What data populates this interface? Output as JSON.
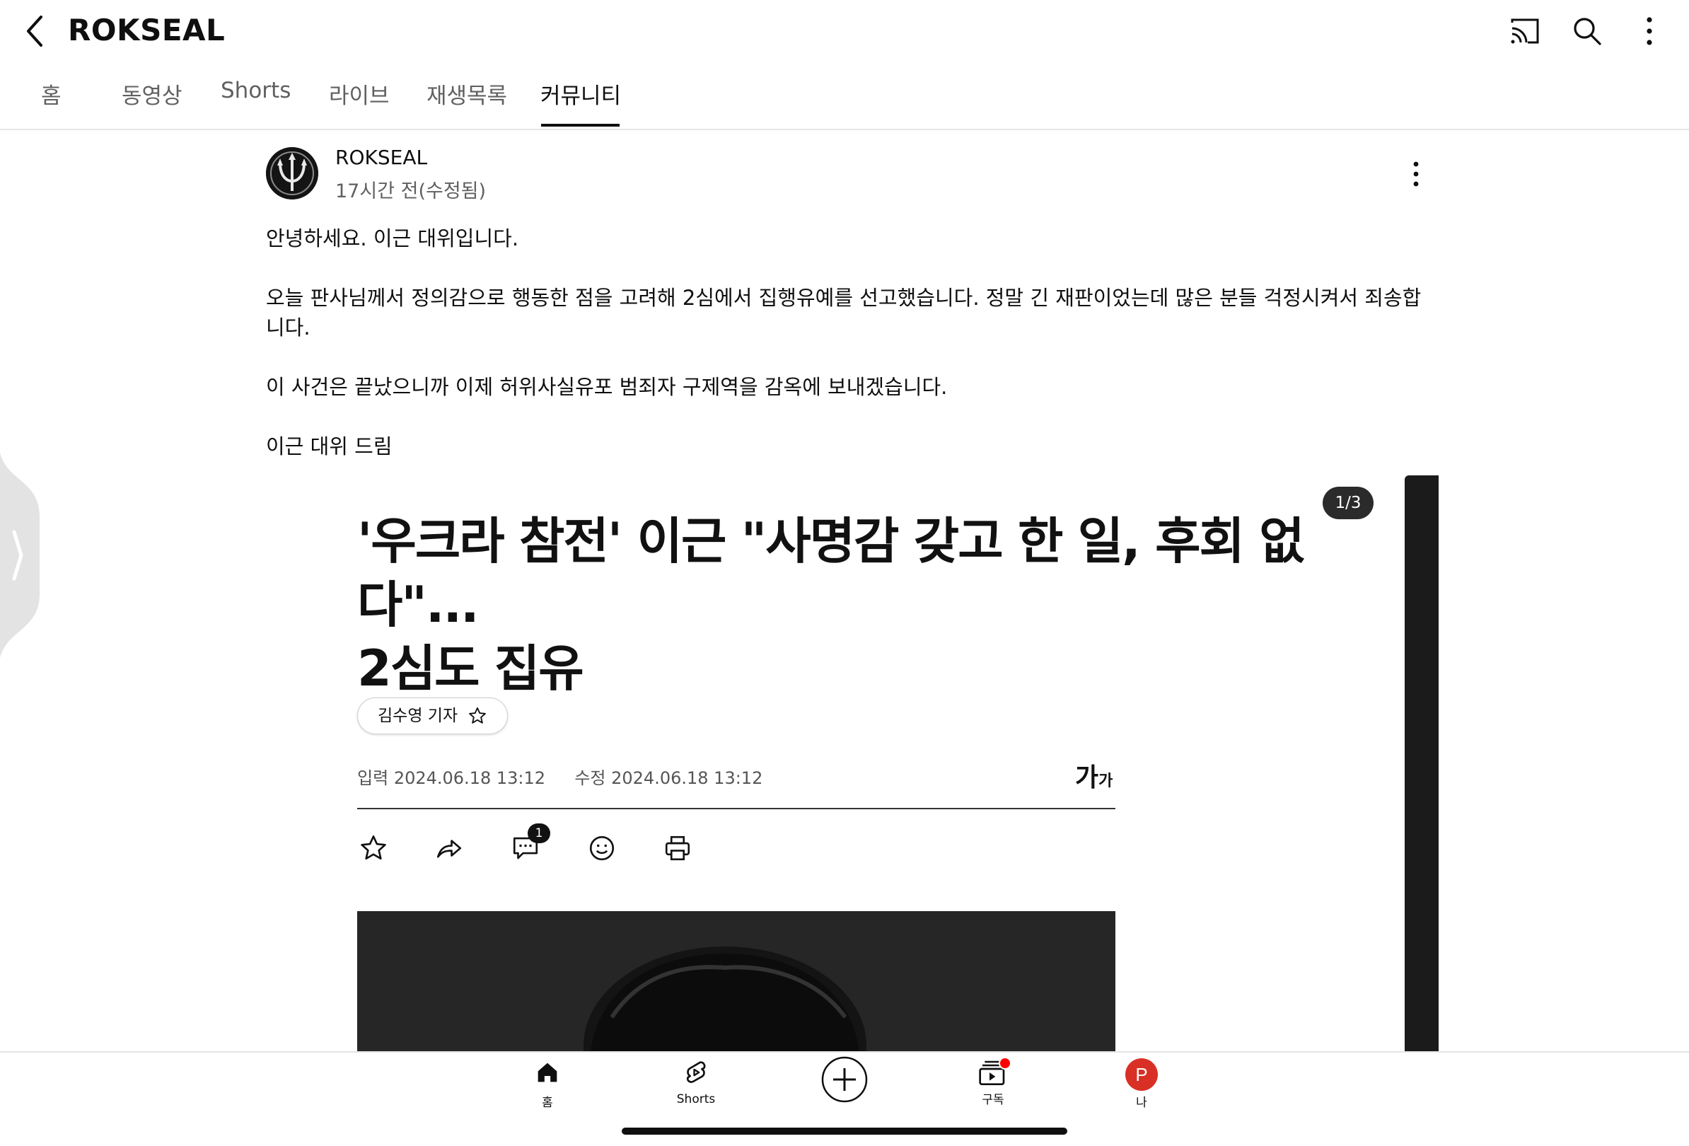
{
  "header": {
    "channel_title": "ROKSEAL",
    "icons": [
      "back-arrow-icon",
      "cast-icon",
      "search-icon",
      "more-vert-icon"
    ]
  },
  "tabs": [
    {
      "label": "홈"
    },
    {
      "label": "동영상"
    },
    {
      "label": "Shorts"
    },
    {
      "label": "라이브"
    },
    {
      "label": "재생목록"
    },
    {
      "label": "커뮤니티",
      "active": true
    }
  ],
  "post": {
    "author": "ROKSEAL",
    "time": "17시간 전(수정됨)",
    "paragraphs": [
      "안녕하세요. 이근 대위입니다.",
      "오늘 판사님께서 정의감으로 행동한 점을 고려해 2심에서 집행유예를 선고했습니다. 정말 긴 재판이었는데 많은 분들 걱정시켜서 죄송합니다.",
      "이 사건은 끝났으니까 이제 허위사실유포 범죄자 구제역을 감옥에 보내겠습니다.",
      "이근 대위 드림"
    ],
    "image": {
      "counter": "1/3",
      "headline_line1": "'우크라 참전' 이근 \"사명감 갖고 한 일, 후회 없다\"...",
      "headline_line2": "2심도 집유",
      "reporter": "김수영 기자",
      "input_label": "입력",
      "input_date": "2024.06.18 13:12",
      "edit_label": "수정",
      "edit_date": "2024.06.18 13:12",
      "font_big": "가",
      "font_small": "가",
      "comment_count": "1"
    }
  },
  "bottom_nav": [
    {
      "label": "홈",
      "icon": "home-icon"
    },
    {
      "label": "Shorts",
      "icon": "shorts-icon"
    },
    {
      "label": "",
      "icon": "create-plus-icon"
    },
    {
      "label": "구독",
      "icon": "subscriptions-icon"
    },
    {
      "label": "나",
      "icon": "profile-avatar",
      "avatar_letter": "P"
    }
  ],
  "colors": {
    "text": "#0f0f0f",
    "muted": "#606060",
    "notif_dot": "#ff0000",
    "avatar_bg": "#d93025"
  }
}
